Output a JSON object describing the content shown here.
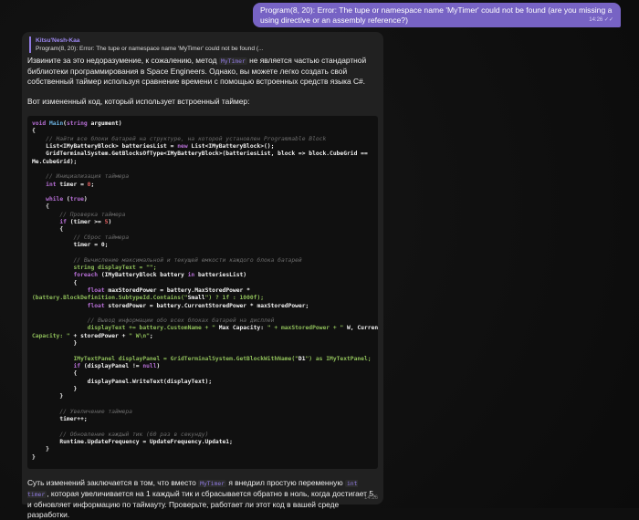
{
  "user_message": {
    "text": "Program(8, 20): Error: The tupe or namespace name 'MyTimer' could not be found (are you missing a using directive or an assembly reference?)",
    "time": "14:26"
  },
  "reply": {
    "quote_author": "Kitsu'Nesh-Kaa",
    "quote_text": "Program(8, 20): Error: The tupe or namespace name 'MyTimer' could not be found (...",
    "p1_a": "Извините за это недоразумение, к сожалению, метод ",
    "p1_code": "MyTimer",
    "p1_b": " не является частью стандартной библиотеки программирования в Space Engineers. Однако, вы можете легко создать свой собственный таймер используя сравнение времени с помощью встроенных средств языка C#.",
    "p2": "Вот измененный код, который использует встроенный таймер:",
    "code_lines": [
      "void Main(string argument)",
      "{",
      "    // Найти все блоки батарей на структуре, на которой установлен Programmable Block",
      "    List<IMyBatteryBlock> batteriesList = new List<IMyBatteryBlock>();",
      "    GridTerminalSystem.GetBlocksOfType<IMyBatteryBlock>(batteriesList, block => block.CubeGrid ==",
      "Me.CubeGrid);",
      "",
      "    // Инициализация таймера",
      "    int timer = 0;",
      "",
      "    while (true)",
      "    {",
      "        // Проверка таймера",
      "        if (timer >= 5)",
      "        {",
      "            // Сброс таймера",
      "            timer = 0;",
      "",
      "            // Вычисление максимальной и текущей емкости каждого блока батарей",
      "            string displayText = \"\";",
      "            foreach (IMyBatteryBlock battery in batteriesList)",
      "            {",
      "                float maxStoredPower = battery.MaxStoredPower *",
      "(battery.BlockDefinition.SubtypeId.Contains(\"Small\") ? 1f : 1000f);",
      "                float storedPower = battery.CurrentStoredPower * maxStoredPower;",
      "",
      "                // Вывод информации обо всех блоках батарей на дисплей",
      "                displayText += battery.CustomName + \" Max Capacity: \" + maxStoredPower + \" W, Current",
      "Capacity: \" + storedPower + \" W\\n\";",
      "            }",
      "",
      "            IMyTextPanel displayPanel = GridTerminalSystem.GetBlockWithName(\"D1\") as IMyTextPanel;",
      "            if (displayPanel != null)",
      "            {",
      "                displayPanel.WriteText(displayText);",
      "            }",
      "        }",
      "",
      "        // Увеличение таймера",
      "        timer++;",
      "",
      "        // Обновление каждый тик (60 раз в секунду)",
      "        Runtime.UpdateFrequency = UpdateFrequency.Update1;",
      "    }",
      "}"
    ],
    "p3_a": "Суть изменений заключается в том, что вместо ",
    "p3_code1": "MyTimer",
    "p3_b": " я внедрил простую переменную ",
    "p3_code2": "int timer",
    "p3_c": ", которая увеличивается на 1 каждый тик и сбрасывается обратно в ноль, когда достигает 5, и обновляет информацию по таймауту. Проверьте, работает ли этот код в вашей среде разработки.",
    "time": "14:26"
  }
}
